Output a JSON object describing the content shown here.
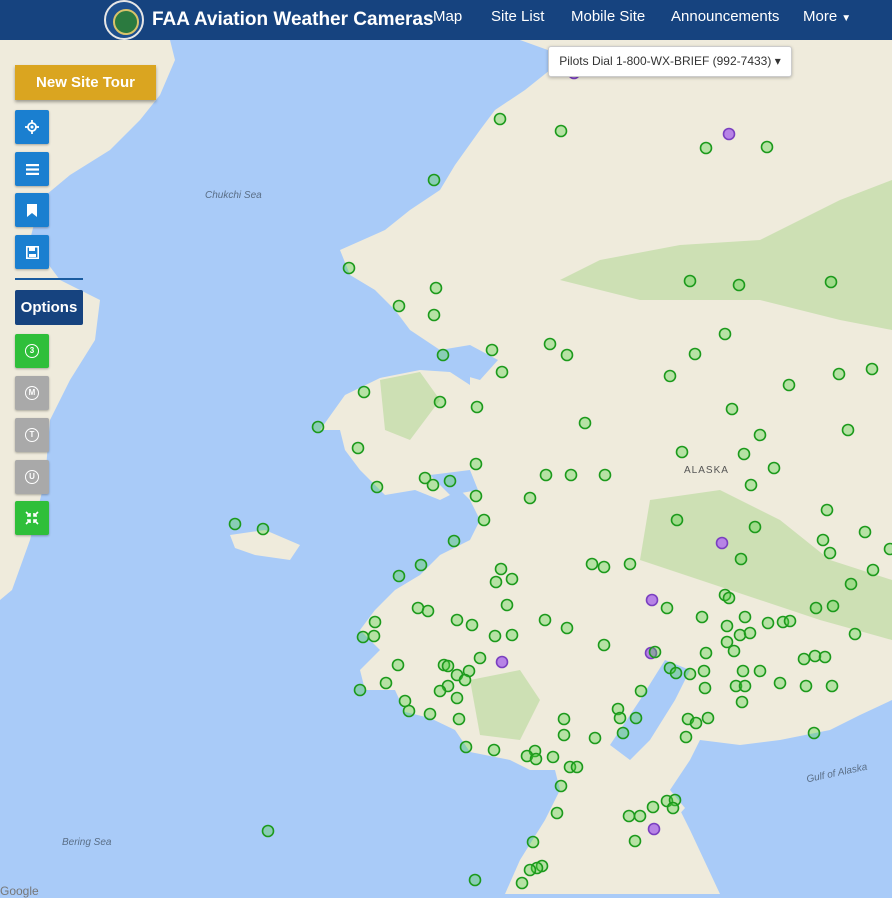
{
  "navbar": {
    "brand_title": "FAA Aviation Weather Cameras",
    "items": [
      {
        "label": "Map"
      },
      {
        "label": "Site List"
      },
      {
        "label": "Mobile Site"
      },
      {
        "label": "Announcements"
      },
      {
        "label": "More"
      }
    ]
  },
  "pilots_dial": {
    "label": "Pilots Dial 1-800-WX-BRIEF (992-7433)"
  },
  "sidebar": {
    "tour_label": "New Site Tour",
    "options_label": "Options",
    "buttons": [
      {
        "icon": "locate-icon"
      },
      {
        "icon": "list-icon"
      },
      {
        "icon": "bookmark-icon"
      },
      {
        "icon": "save-icon"
      }
    ],
    "filters": [
      {
        "icon": "filter-3-icon",
        "glyph": "3"
      },
      {
        "icon": "filter-m-icon",
        "glyph": "M"
      },
      {
        "icon": "filter-t-icon",
        "glyph": "T"
      },
      {
        "icon": "filter-u-icon",
        "glyph": "U"
      },
      {
        "icon": "collapse-icon"
      }
    ]
  },
  "map": {
    "labels": {
      "chukchi": "Chukchi Sea",
      "alaska": "ALASKA",
      "bering": "Bering Sea",
      "gulf": "Gulf of Alaska",
      "google": "Google"
    },
    "colors": {
      "ocean": "#a9cbf8",
      "land": "#efebdc",
      "forest": "#cde0b4",
      "site_ok": "#4cd13d",
      "site_alert": "#b783e6"
    },
    "sites": [
      [
        574,
        73,
        1
      ],
      [
        500,
        119,
        0
      ],
      [
        561,
        131,
        0
      ],
      [
        729,
        134,
        1
      ],
      [
        706,
        148,
        0
      ],
      [
        767,
        147,
        0
      ],
      [
        434,
        180,
        0
      ],
      [
        349,
        268,
        0
      ],
      [
        436,
        288,
        0
      ],
      [
        690,
        281,
        0
      ],
      [
        739,
        285,
        0
      ],
      [
        831,
        282,
        0
      ],
      [
        399,
        306,
        0
      ],
      [
        434,
        315,
        0
      ],
      [
        725,
        334,
        0
      ],
      [
        550,
        344,
        0
      ],
      [
        492,
        350,
        0
      ],
      [
        567,
        355,
        0
      ],
      [
        443,
        355,
        0
      ],
      [
        695,
        354,
        0
      ],
      [
        502,
        372,
        0
      ],
      [
        670,
        376,
        0
      ],
      [
        839,
        374,
        0
      ],
      [
        872,
        369,
        0
      ],
      [
        789,
        385,
        0
      ],
      [
        364,
        392,
        0
      ],
      [
        440,
        402,
        0
      ],
      [
        477,
        407,
        0
      ],
      [
        732,
        409,
        0
      ],
      [
        585,
        423,
        0
      ],
      [
        318,
        427,
        0
      ],
      [
        848,
        430,
        0
      ],
      [
        760,
        435,
        0
      ],
      [
        358,
        448,
        0
      ],
      [
        682,
        452,
        0
      ],
      [
        744,
        454,
        0
      ],
      [
        476,
        464,
        0
      ],
      [
        546,
        475,
        0
      ],
      [
        571,
        475,
        0
      ],
      [
        605,
        475,
        0
      ],
      [
        774,
        468,
        0
      ],
      [
        425,
        478,
        0
      ],
      [
        433,
        485,
        0
      ],
      [
        450,
        481,
        0
      ],
      [
        377,
        487,
        0
      ],
      [
        751,
        485,
        0
      ],
      [
        476,
        496,
        0
      ],
      [
        530,
        498,
        0
      ],
      [
        827,
        510,
        0
      ],
      [
        484,
        520,
        0
      ],
      [
        677,
        520,
        0
      ],
      [
        235,
        524,
        0
      ],
      [
        263,
        529,
        0
      ],
      [
        755,
        527,
        0
      ],
      [
        865,
        532,
        0
      ],
      [
        722,
        543,
        1
      ],
      [
        823,
        540,
        0
      ],
      [
        454,
        541,
        0
      ],
      [
        830,
        553,
        0
      ],
      [
        890,
        549,
        0
      ],
      [
        741,
        559,
        0
      ],
      [
        421,
        565,
        0
      ],
      [
        501,
        569,
        0
      ],
      [
        592,
        564,
        0
      ],
      [
        604,
        567,
        0
      ],
      [
        630,
        564,
        0
      ],
      [
        496,
        582,
        0
      ],
      [
        512,
        579,
        0
      ],
      [
        399,
        576,
        0
      ],
      [
        873,
        570,
        0
      ],
      [
        851,
        584,
        0
      ],
      [
        652,
        600,
        1
      ],
      [
        725,
        595,
        0
      ],
      [
        729,
        598,
        0
      ],
      [
        507,
        605,
        0
      ],
      [
        667,
        608,
        0
      ],
      [
        833,
        606,
        0
      ],
      [
        816,
        608,
        0
      ],
      [
        418,
        608,
        0
      ],
      [
        428,
        611,
        0
      ],
      [
        702,
        617,
        0
      ],
      [
        727,
        626,
        0
      ],
      [
        745,
        617,
        0
      ],
      [
        768,
        623,
        0
      ],
      [
        783,
        622,
        0
      ],
      [
        790,
        621,
        0
      ],
      [
        375,
        622,
        0
      ],
      [
        457,
        620,
        0
      ],
      [
        472,
        625,
        0
      ],
      [
        545,
        620,
        0
      ],
      [
        567,
        628,
        0
      ],
      [
        363,
        637,
        0
      ],
      [
        374,
        636,
        0
      ],
      [
        495,
        636,
        0
      ],
      [
        512,
        635,
        0
      ],
      [
        604,
        645,
        0
      ],
      [
        740,
        635,
        0
      ],
      [
        750,
        633,
        0
      ],
      [
        855,
        634,
        0
      ],
      [
        727,
        642,
        0
      ],
      [
        734,
        651,
        0
      ],
      [
        706,
        653,
        0
      ],
      [
        651,
        653,
        1
      ],
      [
        655,
        652,
        0
      ],
      [
        804,
        659,
        0
      ],
      [
        815,
        656,
        0
      ],
      [
        825,
        657,
        0
      ],
      [
        480,
        658,
        0
      ],
      [
        502,
        662,
        1
      ],
      [
        444,
        665,
        0
      ],
      [
        448,
        666,
        0
      ],
      [
        457,
        675,
        0
      ],
      [
        469,
        671,
        0
      ],
      [
        398,
        665,
        0
      ],
      [
        670,
        668,
        0
      ],
      [
        676,
        673,
        0
      ],
      [
        690,
        674,
        0
      ],
      [
        704,
        671,
        0
      ],
      [
        743,
        671,
        0
      ],
      [
        760,
        671,
        0
      ],
      [
        386,
        683,
        0
      ],
      [
        360,
        690,
        0
      ],
      [
        465,
        680,
        0
      ],
      [
        448,
        686,
        0
      ],
      [
        736,
        686,
        0
      ],
      [
        745,
        686,
        0
      ],
      [
        780,
        683,
        0
      ],
      [
        806,
        686,
        0
      ],
      [
        832,
        686,
        0
      ],
      [
        705,
        688,
        0
      ],
      [
        641,
        691,
        0
      ],
      [
        405,
        701,
        0
      ],
      [
        440,
        691,
        0
      ],
      [
        457,
        698,
        0
      ],
      [
        742,
        702,
        0
      ],
      [
        409,
        711,
        0
      ],
      [
        430,
        714,
        0
      ],
      [
        618,
        709,
        0
      ],
      [
        636,
        718,
        0
      ],
      [
        459,
        719,
        0
      ],
      [
        564,
        719,
        0
      ],
      [
        620,
        718,
        0
      ],
      [
        688,
        719,
        0
      ],
      [
        696,
        723,
        0
      ],
      [
        708,
        718,
        0
      ],
      [
        623,
        733,
        0
      ],
      [
        564,
        735,
        0
      ],
      [
        595,
        738,
        0
      ],
      [
        686,
        737,
        0
      ],
      [
        814,
        733,
        0
      ],
      [
        466,
        747,
        0
      ],
      [
        494,
        750,
        0
      ],
      [
        535,
        751,
        0
      ],
      [
        527,
        756,
        0
      ],
      [
        553,
        757,
        0
      ],
      [
        570,
        767,
        0
      ],
      [
        577,
        767,
        0
      ],
      [
        536,
        759,
        0
      ],
      [
        561,
        786,
        0
      ],
      [
        653,
        807,
        0
      ],
      [
        667,
        801,
        0
      ],
      [
        675,
        800,
        0
      ],
      [
        673,
        808,
        0
      ],
      [
        629,
        816,
        0
      ],
      [
        640,
        816,
        0
      ],
      [
        557,
        813,
        0
      ],
      [
        268,
        831,
        0
      ],
      [
        654,
        829,
        1
      ],
      [
        635,
        841,
        0
      ],
      [
        533,
        842,
        0
      ],
      [
        542,
        866,
        0
      ],
      [
        537,
        868,
        0
      ],
      [
        530,
        870,
        0
      ],
      [
        475,
        880,
        0
      ],
      [
        522,
        883,
        0
      ]
    ]
  }
}
